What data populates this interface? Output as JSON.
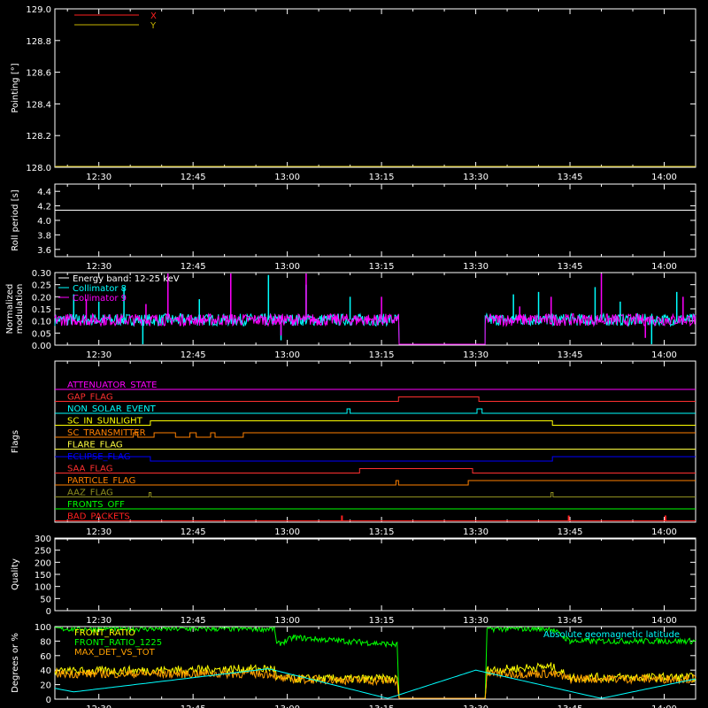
{
  "time_axis": {
    "ticks": [
      "12:30",
      "12:45",
      "13:00",
      "13:15",
      "13:30",
      "13:45",
      "14:00"
    ],
    "tick_minutes": [
      750,
      765,
      780,
      795,
      810,
      825,
      840
    ],
    "range_minutes": [
      743,
      845
    ]
  },
  "chart_data": [
    {
      "id": "pointing",
      "type": "line",
      "ylabel": "Pointing [°]",
      "ylim": [
        128.0,
        129.0
      ],
      "yticks": [
        "128.0",
        "128.2",
        "128.4",
        "128.6",
        "128.8",
        "129.0"
      ],
      "ytick_values": [
        128.0,
        128.2,
        128.4,
        128.6,
        128.8,
        129.0
      ],
      "legend": [
        {
          "name": "X",
          "color": "#ff2020"
        },
        {
          "name": "Y",
          "color": "#c8b400"
        }
      ],
      "series": [
        {
          "name": "X",
          "color": "#ff2020",
          "x": [
            743,
            845
          ],
          "values": [
            128.0,
            128.0
          ]
        },
        {
          "name": "Y",
          "color": "#c8b400",
          "x": [
            743,
            845
          ],
          "values": [
            128.0,
            128.0
          ]
        }
      ]
    },
    {
      "id": "roll",
      "type": "line",
      "ylabel": "Roll period [s]",
      "ylim": [
        3.5,
        4.5
      ],
      "yticks": [
        "3.6",
        "3.8",
        "4.0",
        "4.2",
        "4.4"
      ],
      "ytick_values": [
        3.6,
        3.8,
        4.0,
        4.2,
        4.4
      ],
      "series": [
        {
          "name": "",
          "color": "#ffffff",
          "x": [
            743,
            845
          ],
          "values": [
            4.14,
            4.14
          ]
        }
      ]
    },
    {
      "id": "modulation",
      "type": "line",
      "ylabel": [
        "Normalized",
        "modulation"
      ],
      "ylim": [
        0.0,
        0.3
      ],
      "yticks": [
        "0.00",
        "0.05",
        "0.10",
        "0.15",
        "0.20",
        "0.25",
        "0.30"
      ],
      "ytick_values": [
        0.0,
        0.05,
        0.1,
        0.15,
        0.2,
        0.25,
        0.3
      ],
      "legend": [
        {
          "name": "Energy band: 12-25 keV",
          "color": "#ffffff"
        },
        {
          "name": "Collimator 8",
          "color": "#00ffff"
        },
        {
          "name": "Collimator 9",
          "color": "#ff00ff"
        }
      ],
      "segments": [
        [
          743,
          797.8,
          0.105
        ],
        [
          797.8,
          811.5,
          0.0
        ],
        [
          811.5,
          845,
          0.105
        ]
      ],
      "series": [
        {
          "name": "Collimator 8",
          "color": "#00ffff",
          "x": [
            746,
            750,
            754,
            757,
            766,
            771,
            777,
            779,
            783,
            790,
            816,
            820,
            829,
            833,
            838,
            842
          ],
          "values": [
            0.21,
            0.18,
            0.24,
            0.0,
            0.19,
            0.22,
            0.29,
            0.02,
            0.25,
            0.2,
            0.21,
            0.22,
            0.24,
            0.18,
            0.0,
            0.22
          ]
        },
        {
          "name": "Collimator 9",
          "color": "#ff00ff",
          "x": [
            748,
            757.5,
            761,
            771,
            779,
            783,
            795,
            817,
            822,
            830,
            837,
            843
          ],
          "values": [
            0.19,
            0.17,
            0.3,
            0.3,
            0.04,
            0.3,
            0.2,
            0.16,
            0.2,
            0.3,
            0.03,
            0.2
          ]
        }
      ]
    },
    {
      "id": "flags",
      "type": "line",
      "ylabel": "Flags",
      "flags": [
        {
          "name": "ATTENUATOR_STATE",
          "color": "#ff00ff",
          "transitions": [],
          "initial": 0
        },
        {
          "name": "GAP_FLAG",
          "color": "#ff3030",
          "transitions": [
            797.7,
            810.5
          ],
          "initial": 0
        },
        {
          "name": "NON_SOLAR_EVENT",
          "color": "#00ffff",
          "transitions": [
            789.5,
            790.0,
            810.2,
            811.0
          ],
          "initial": 0
        },
        {
          "name": "SC_IN_SUNLIGHT",
          "color": "#ffff00",
          "transitions": [
            758.2,
            822.2
          ],
          "initial": 0
        },
        {
          "name": "SC_TRANSMITTER",
          "color": "#ff8000",
          "transitions": [
            755.5,
            756.2,
            758.8,
            762.2,
            764.5,
            765.5,
            767.8,
            768.5,
            773.0
          ],
          "initial": 0
        },
        {
          "name": "FLARE_FLAG",
          "color": "#ffff40",
          "transitions": [],
          "initial": 0
        },
        {
          "name": "ECLIPSE_FLAG",
          "color": "#0000ff",
          "transitions": [
            758.2,
            822.2
          ],
          "initial": 1
        },
        {
          "name": "SAA_FLAG",
          "color": "#ff3030",
          "transitions": [
            791.5,
            809.5
          ],
          "initial": 0
        },
        {
          "name": "PARTICLE_FLAG",
          "color": "#ff8000",
          "transitions": [
            797.3,
            797.7,
            808.8
          ],
          "initial": 0
        },
        {
          "name": "AAZ_FLAG",
          "color": "#909020",
          "transitions": [
            758.0,
            758.3,
            822.0,
            822.3
          ],
          "initial": 0
        },
        {
          "name": "FRONTS_OFF",
          "color": "#00ff00",
          "transitions": [],
          "initial": 0
        },
        {
          "name": "BAD_PACKETS",
          "color": "#ff2020",
          "transitions": [],
          "initial": 0,
          "spikes": [
            788.7,
            824.8,
            840.2
          ]
        }
      ]
    },
    {
      "id": "quality",
      "type": "line",
      "ylabel": "Quality",
      "ylim": [
        0,
        300
      ],
      "yticks": [
        "0",
        "50",
        "100",
        "150",
        "200",
        "250",
        "300"
      ],
      "ytick_values": [
        0,
        50,
        100,
        150,
        200,
        250,
        300
      ],
      "series": [
        {
          "name": "",
          "color": "#ffffff",
          "x": [
            743,
            845
          ],
          "values": [
            300,
            300
          ]
        }
      ]
    },
    {
      "id": "ratios",
      "type": "line",
      "ylabel": "Degrees or %",
      "ylim": [
        0,
        100
      ],
      "yticks": [
        "0",
        "20",
        "40",
        "60",
        "80",
        "100"
      ],
      "ytick_values": [
        0,
        20,
        40,
        60,
        80,
        100
      ],
      "legend": [
        {
          "name": "FRONT_RATIO",
          "color": "#ffff00"
        },
        {
          "name": "FRONT_RATIO_1225",
          "color": "#00ff00"
        },
        {
          "name": "MAX_DET_VS_TOT",
          "color": "#ffa000"
        }
      ],
      "annotation": {
        "text": "Absolute geomagnetic latitude",
        "color": "#00ffff"
      },
      "series": [
        {
          "name": "FRONT_RATIO_1225",
          "color": "#00ff00",
          "x": [
            743,
            778,
            778.3,
            781,
            797.5,
            797.8,
            811.5,
            811.8,
            822,
            825,
            845
          ],
          "values": [
            97,
            97,
            75,
            85,
            75,
            0,
            0,
            97,
            97,
            80,
            80
          ]
        },
        {
          "name": "FRONT_RATIO",
          "color": "#ffff00",
          "x": [
            743,
            778,
            778.3,
            797.5,
            797.8,
            811.5,
            811.8,
            822,
            825,
            845
          ],
          "values": [
            38,
            42,
            28,
            28,
            0,
            0,
            40,
            45,
            30,
            30
          ]
        },
        {
          "name": "MAX_DET_VS_TOT",
          "color": "#ffa000",
          "x": [
            743,
            778,
            778.3,
            797.5,
            797.8,
            811.5,
            811.8,
            822,
            825,
            845
          ],
          "values": [
            35,
            35,
            28,
            25,
            0,
            0,
            35,
            35,
            28,
            28
          ]
        },
        {
          "name": "Absolute geomagnetic latitude",
          "color": "#00ffff",
          "x": [
            743,
            746,
            777,
            796,
            810,
            830,
            845
          ],
          "values": [
            15,
            10,
            42,
            1,
            40,
            1,
            28
          ]
        }
      ]
    }
  ]
}
